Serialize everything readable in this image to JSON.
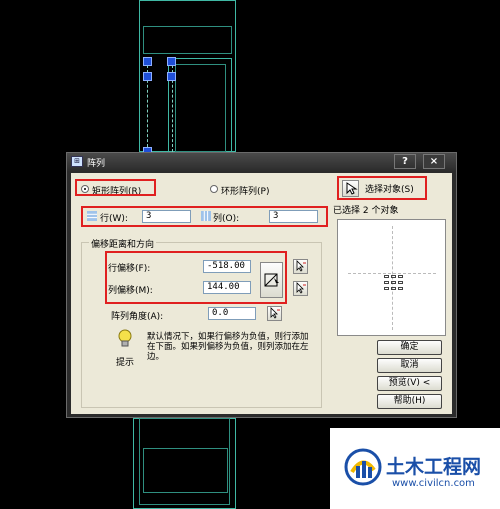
{
  "dialog": {
    "title": "阵列",
    "help_button": "?",
    "close_button": "×"
  },
  "array_type": {
    "rect_label": "矩形阵列(R)",
    "polar_label": "环形阵列(P)",
    "selected": "rect"
  },
  "select_objects": {
    "button_label": "选择对象(S)",
    "status": "已选择 2 个对象"
  },
  "rows": {
    "label": "行(W):",
    "value": "3"
  },
  "columns": {
    "label": "列(O):",
    "value": "3"
  },
  "offset_group": {
    "title": "偏移距离和方向",
    "row_offset_label": "行偏移(F):",
    "row_offset_value": "-518.00",
    "col_offset_label": "列偏移(M):",
    "col_offset_value": "144.00",
    "angle_label": "阵列角度(A):",
    "angle_value": "0.0"
  },
  "tip": {
    "label": "提示",
    "text": "默认情况下，如果行偏移为负值，则行添加在下面。如果列偏移为负值，则列添加在左边。"
  },
  "buttons": {
    "ok": "确定",
    "cancel": "取消",
    "preview": "预览(V) <",
    "help": "帮助(H)"
  },
  "watermark": {
    "brand": "土木工程网",
    "url": "www.civilcn.com"
  },
  "colors": {
    "highlight": "#e02020",
    "drawing_lines": "#3fb8a4",
    "grips": "#1f4fd8",
    "brand_blue": "#1a4fa8"
  }
}
